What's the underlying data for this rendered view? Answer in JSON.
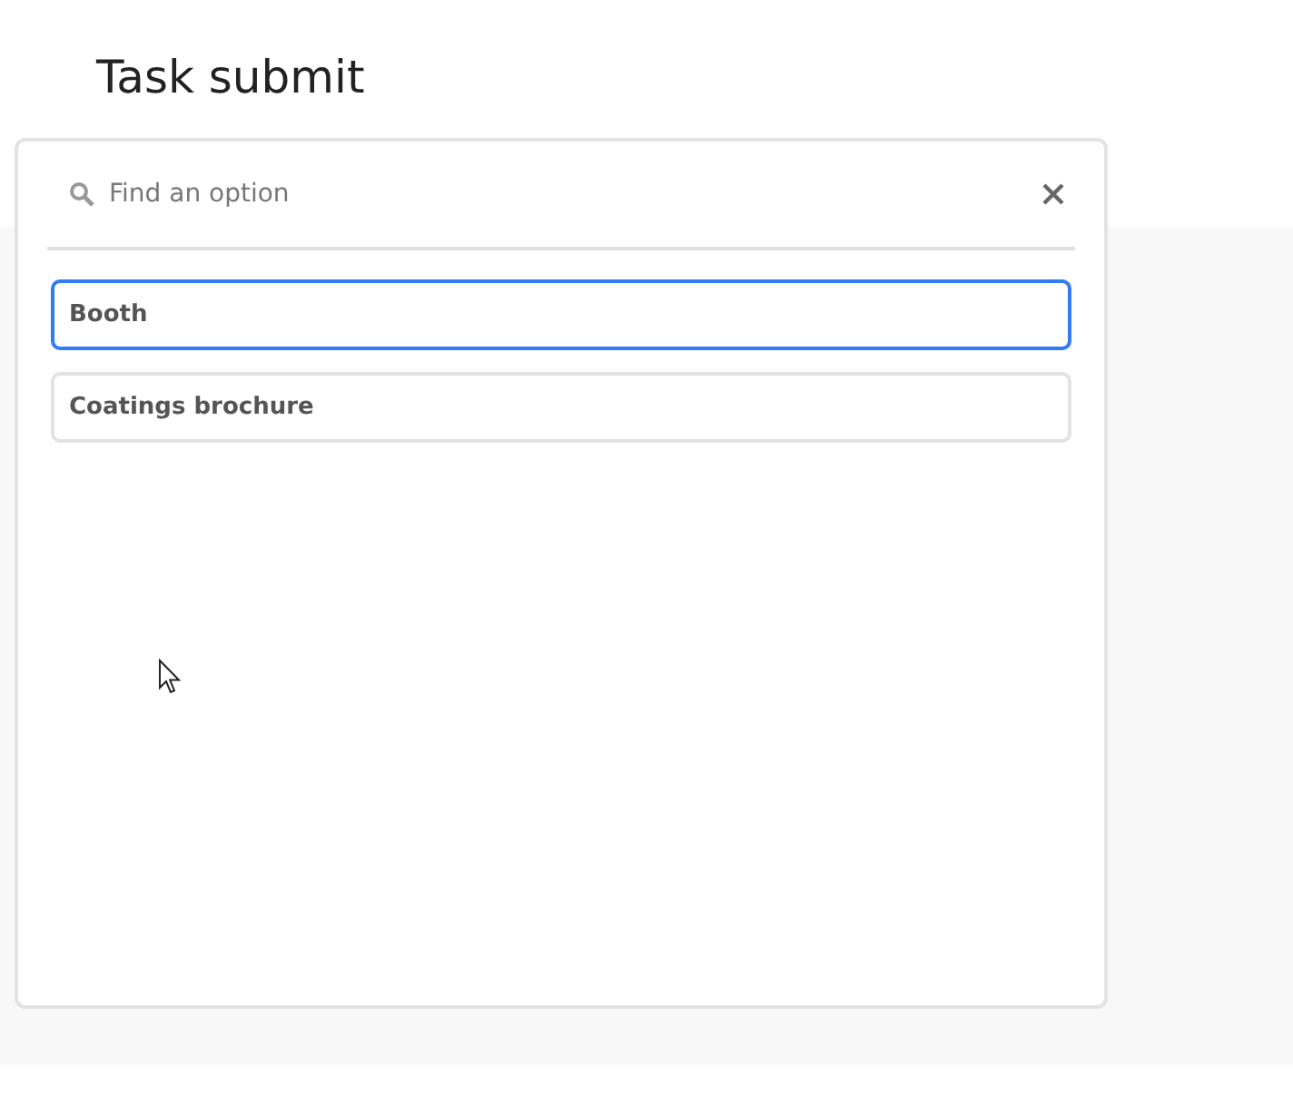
{
  "page": {
    "title": "Task submit"
  },
  "picker": {
    "search": {
      "placeholder": "Find an option"
    },
    "options": [
      {
        "label": "Booth",
        "selected": true
      },
      {
        "label": "Coatings brochure",
        "selected": false
      }
    ]
  }
}
